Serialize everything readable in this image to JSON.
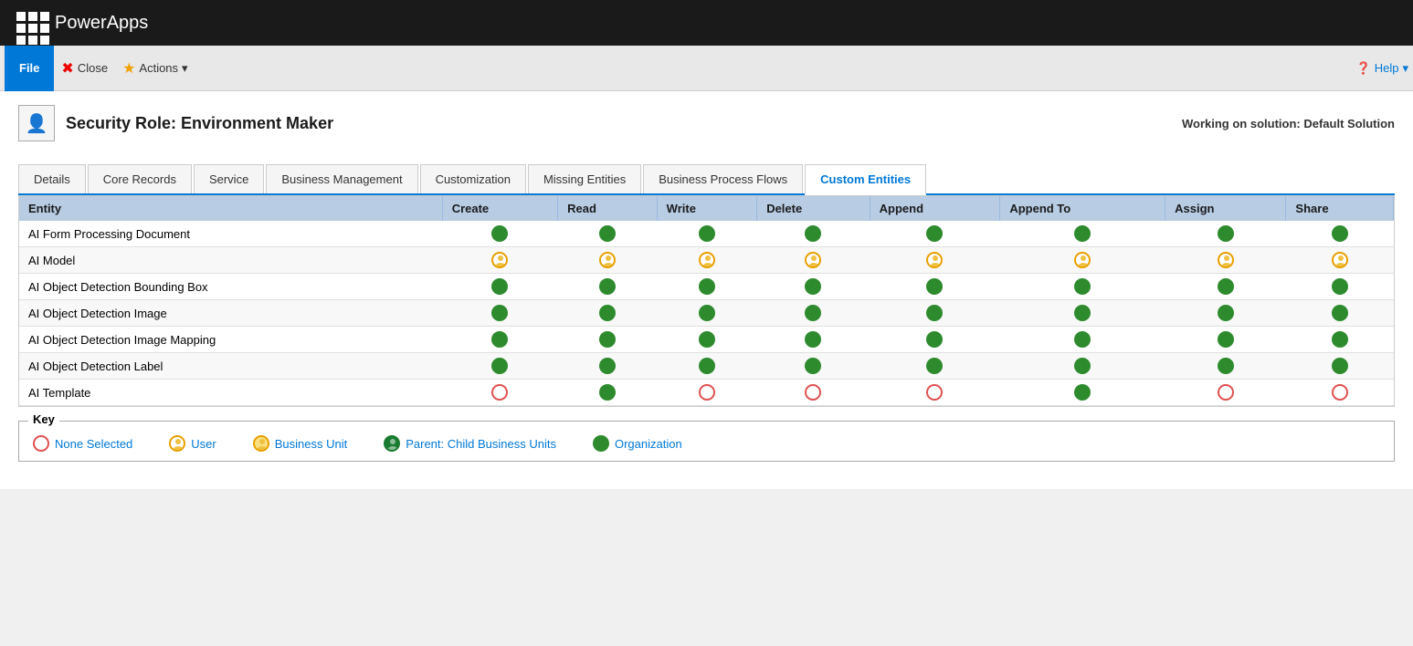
{
  "topbar": {
    "app_name": "PowerApps"
  },
  "toolbar": {
    "file_label": "File",
    "close_label": "Close",
    "actions_label": "Actions",
    "help_label": "Help"
  },
  "page_header": {
    "title": "Security Role: Environment Maker",
    "working_on": "Working on solution: Default Solution",
    "icon": "👤"
  },
  "tabs": [
    {
      "id": "details",
      "label": "Details",
      "active": false
    },
    {
      "id": "core-records",
      "label": "Core Records",
      "active": false
    },
    {
      "id": "service",
      "label": "Service",
      "active": false
    },
    {
      "id": "business-management",
      "label": "Business Management",
      "active": false
    },
    {
      "id": "customization",
      "label": "Customization",
      "active": false
    },
    {
      "id": "missing-entities",
      "label": "Missing Entities",
      "active": false
    },
    {
      "id": "business-process-flows",
      "label": "Business Process Flows",
      "active": false
    },
    {
      "id": "custom-entities",
      "label": "Custom Entities",
      "active": true
    }
  ],
  "table": {
    "columns": [
      "Entity",
      "Create",
      "Read",
      "Write",
      "Delete",
      "Append",
      "Append To",
      "Assign",
      "Share"
    ],
    "rows": [
      {
        "entity": "AI Form Processing Document",
        "permissions": [
          "green",
          "green",
          "green",
          "green",
          "green",
          "green",
          "green",
          "green"
        ]
      },
      {
        "entity": "AI Model",
        "permissions": [
          "user",
          "user",
          "user",
          "user",
          "user",
          "user",
          "user",
          "user"
        ]
      },
      {
        "entity": "AI Object Detection Bounding Box",
        "permissions": [
          "green",
          "green",
          "green",
          "green",
          "green",
          "green",
          "green",
          "green"
        ]
      },
      {
        "entity": "AI Object Detection Image",
        "permissions": [
          "green",
          "green",
          "green",
          "green",
          "green",
          "green",
          "green",
          "green"
        ]
      },
      {
        "entity": "AI Object Detection Image Mapping",
        "permissions": [
          "green",
          "green",
          "green",
          "green",
          "green",
          "green",
          "green",
          "green"
        ]
      },
      {
        "entity": "AI Object Detection Label",
        "permissions": [
          "green",
          "green",
          "green",
          "green",
          "green",
          "green",
          "green",
          "green"
        ]
      },
      {
        "entity": "AI Template",
        "permissions": [
          "empty",
          "green",
          "empty",
          "empty",
          "empty",
          "green",
          "empty",
          "empty"
        ]
      }
    ]
  },
  "key": {
    "title": "Key",
    "items": [
      {
        "id": "none",
        "type": "empty",
        "label": "None Selected"
      },
      {
        "id": "user",
        "type": "user",
        "label": "User"
      },
      {
        "id": "business-unit",
        "type": "business-unit",
        "label": "Business Unit"
      },
      {
        "id": "parent",
        "type": "parent",
        "label": "Parent: Child Business Units"
      },
      {
        "id": "organization",
        "type": "organization",
        "label": "Organization"
      }
    ]
  }
}
